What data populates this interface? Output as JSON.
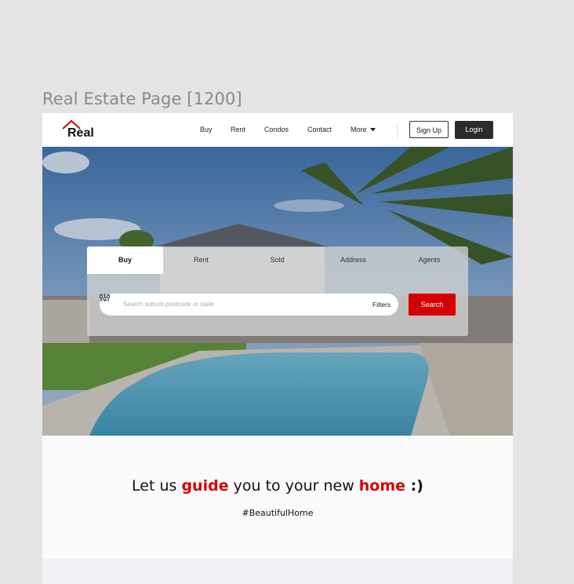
{
  "frame_label": "Real Estate Page [1200]",
  "header": {
    "logo_text": "Real",
    "nav": [
      "Buy",
      "Rent",
      "Condos",
      "Contact"
    ],
    "more_label": "More",
    "signup_label": "Sign Up",
    "login_label": "Login"
  },
  "search": {
    "tabs": [
      "Buy",
      "Rent",
      "Sold",
      "Address",
      "Agents"
    ],
    "active_tab": "Buy",
    "placeholder": "Search suburb,postcode or state",
    "filters_label": "Filters",
    "button_label": "Search"
  },
  "tagline": {
    "part1": "Let us ",
    "highlight1": "guide",
    "part2": " you to your new ",
    "highlight2": "home",
    "part3": " :)"
  },
  "hashtag": "#BeautifulHome",
  "colors": {
    "accent": "#d60000",
    "dark_button": "#2b2b2b"
  }
}
